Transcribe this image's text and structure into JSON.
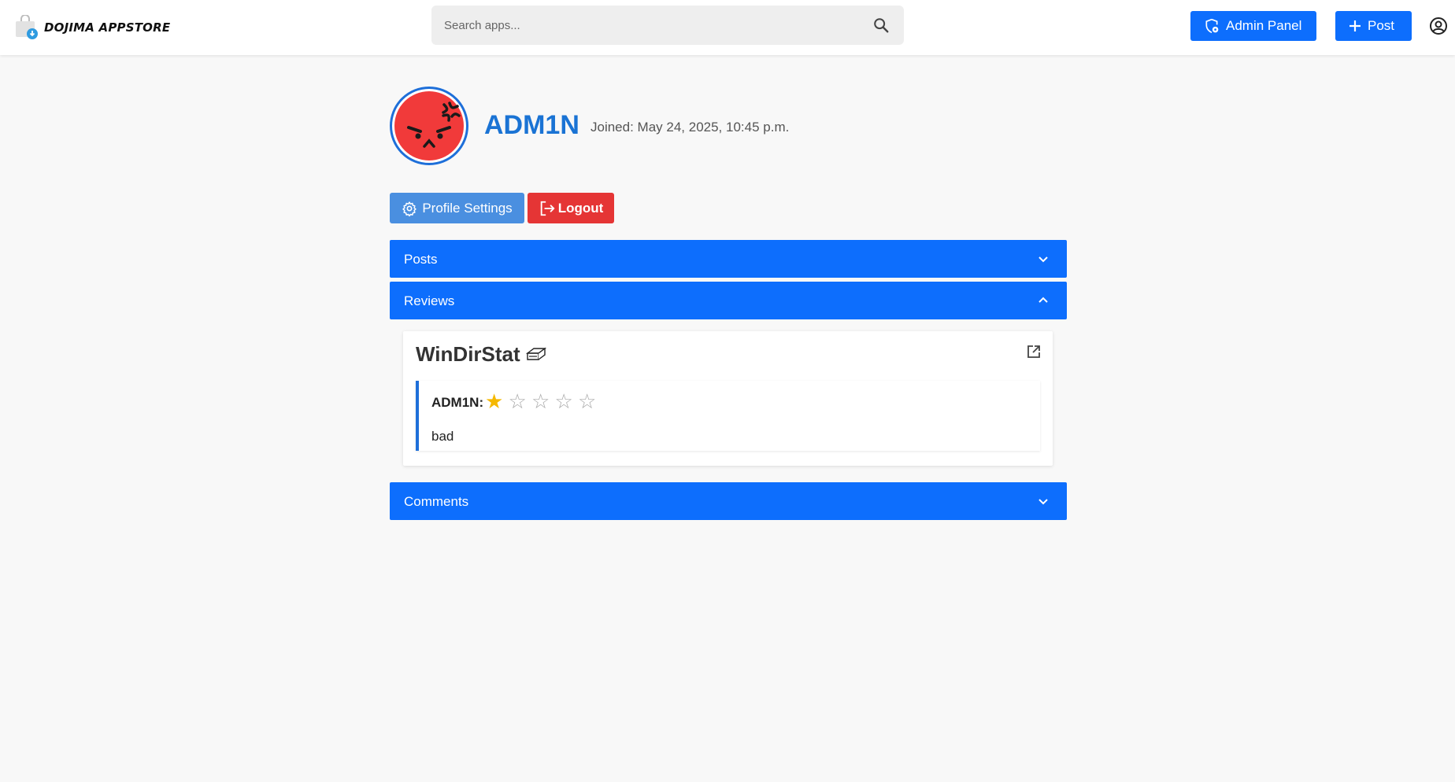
{
  "header": {
    "brand_name": "DOJIMA APPSTORE",
    "brand_icon": "store-bag-icon",
    "search_placeholder": "Search apps...",
    "admin_label": "Admin Panel",
    "post_label": "Post",
    "accent_color": "#0d6efd"
  },
  "profile": {
    "username": "ADM1N",
    "joined": "Joined: May 24, 2025, 10:45 p.m.",
    "avatar": "angry-face-icon",
    "settings_label": "Profile Settings",
    "logout_label": "Logout"
  },
  "sections": {
    "posts": {
      "label": "Posts",
      "expanded": false
    },
    "reviews": {
      "label": "Reviews",
      "expanded": true
    },
    "comments": {
      "label": "Comments",
      "expanded": false
    }
  },
  "reviews": [
    {
      "app_name": "WinDirStat",
      "app_icon": "drive-icon",
      "author": "ADM1N:",
      "rating": 1,
      "max_rating": 5,
      "star_glyphs": [
        "★",
        "☆",
        "☆",
        "☆",
        "☆"
      ],
      "text": "bad"
    }
  ]
}
